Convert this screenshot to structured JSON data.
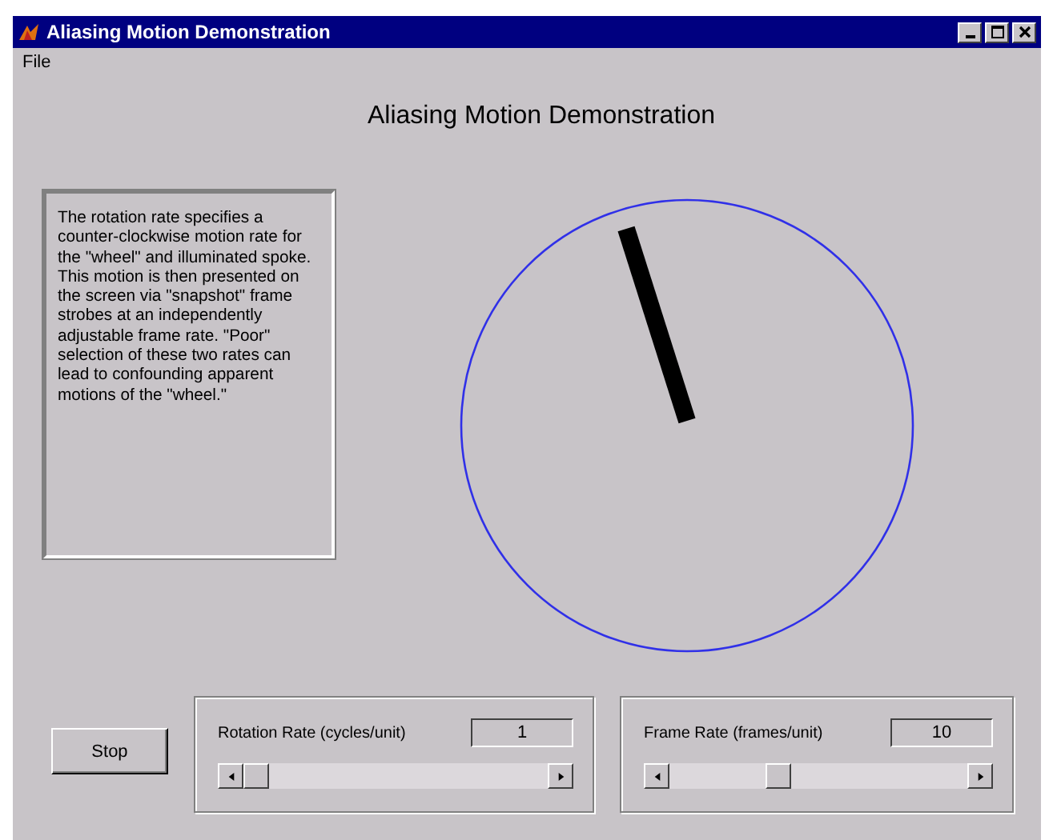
{
  "window": {
    "title": "Aliasing Motion Demonstration"
  },
  "menu": [
    "File"
  ],
  "heading": "Aliasing Motion Demonstration",
  "description": "The rotation rate specifies a counter-clockwise motion rate for the \"wheel\" and illuminated spoke.  This motion is then presented on the screen via \"snapshot\" frame strobes at an independently adjustable frame rate.  \"Poor\" selection of these two rates can lead to confounding apparent motions of the \"wheel.\"",
  "stop_button": "Stop",
  "controls": [
    {
      "label": "Rotation Rate (cycles/unit)",
      "value": "1",
      "level": 0
    },
    {
      "label": "Frame Rate (frames/unit)",
      "value": "10",
      "level": 0.35
    }
  ]
}
